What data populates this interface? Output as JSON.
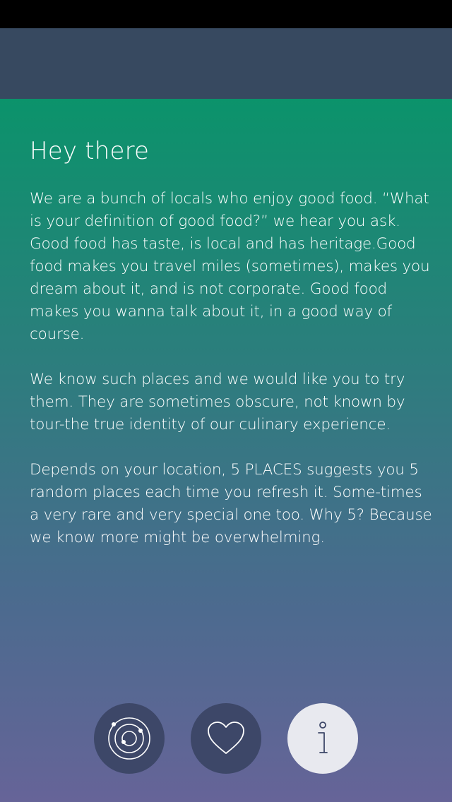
{
  "about": {
    "title": "Hey there",
    "paragraphs": [
      "We are a bunch of locals who enjoy good food. “What is your definition of good food?” we hear you ask. Good food has taste, is local and has heritage.Good food makes you travel miles (sometimes), makes you dream about it, and is not corporate. Good food makes you wanna talk about it, in a good way of course.",
      "We know such places and we would like you to try them. They are sometimes obscure, not known by tour-the true identity of our culinary experience.",
      "Depends on your location, 5 PLACES suggests you 5 random places each time you refresh it. Some-times a very rare and very special one too. Why 5? Because we know more might be overwhelming."
    ]
  },
  "tabs": [
    {
      "icon": "orbit-icon",
      "active": false
    },
    {
      "icon": "heart-icon",
      "active": false
    },
    {
      "icon": "info-icon",
      "active": true
    }
  ],
  "colors": {
    "status_bar": "#000000",
    "nav_bar": "#374960",
    "gradient_top": "#0b936b",
    "gradient_bottom": "#666498",
    "tab_button": "#3d4768",
    "tab_button_active": "#e8e9ef"
  }
}
